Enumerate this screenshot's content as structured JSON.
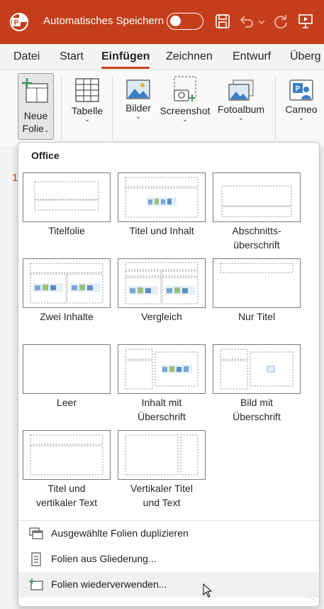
{
  "titlebar": {
    "autosave_label": "Automatisches Speichern",
    "icons": [
      "powerpoint-logo-icon",
      "toggle-switch",
      "save-icon",
      "undo-icon",
      "redo-icon",
      "present-icon"
    ]
  },
  "tabs": [
    "Datei",
    "Start",
    "Einfügen",
    "Zeichnen",
    "Entwurf",
    "Überg"
  ],
  "active_tab": "Einfügen",
  "ribbon": {
    "new_slide": [
      "Neue",
      "Folie"
    ],
    "table": "Tabelle",
    "pictures": "Bilder",
    "screenshot": "Screenshot",
    "photo_album": "Fotoalbum",
    "cameo": "Cameo"
  },
  "slide_number": "1",
  "dropdown": {
    "header": "Office",
    "layouts": [
      {
        "label": "Titelfolie"
      },
      {
        "label": "Titel und Inhalt"
      },
      {
        "label": "Abschnitts-\nüberschrift"
      },
      {
        "label": "Zwei Inhalte"
      },
      {
        "label": "Vergleich"
      },
      {
        "label": "Nur Titel"
      },
      {
        "label": "Leer"
      },
      {
        "label": "Inhalt mit\nÜberschrift"
      },
      {
        "label": "Bild mit\nÜberschrift"
      },
      {
        "label": "Titel und\nvertikaler Text"
      },
      {
        "label": "Vertikaler Titel\nund Text"
      }
    ],
    "menu_items": [
      "Ausgewählte Folien duplizieren",
      "Folien aus Gliederung...",
      "Folien wiederverwenden..."
    ]
  },
  "colors": {
    "accent": "#c43e1c",
    "hover": "#f0f0f0",
    "outline": "#7a7a7a"
  }
}
